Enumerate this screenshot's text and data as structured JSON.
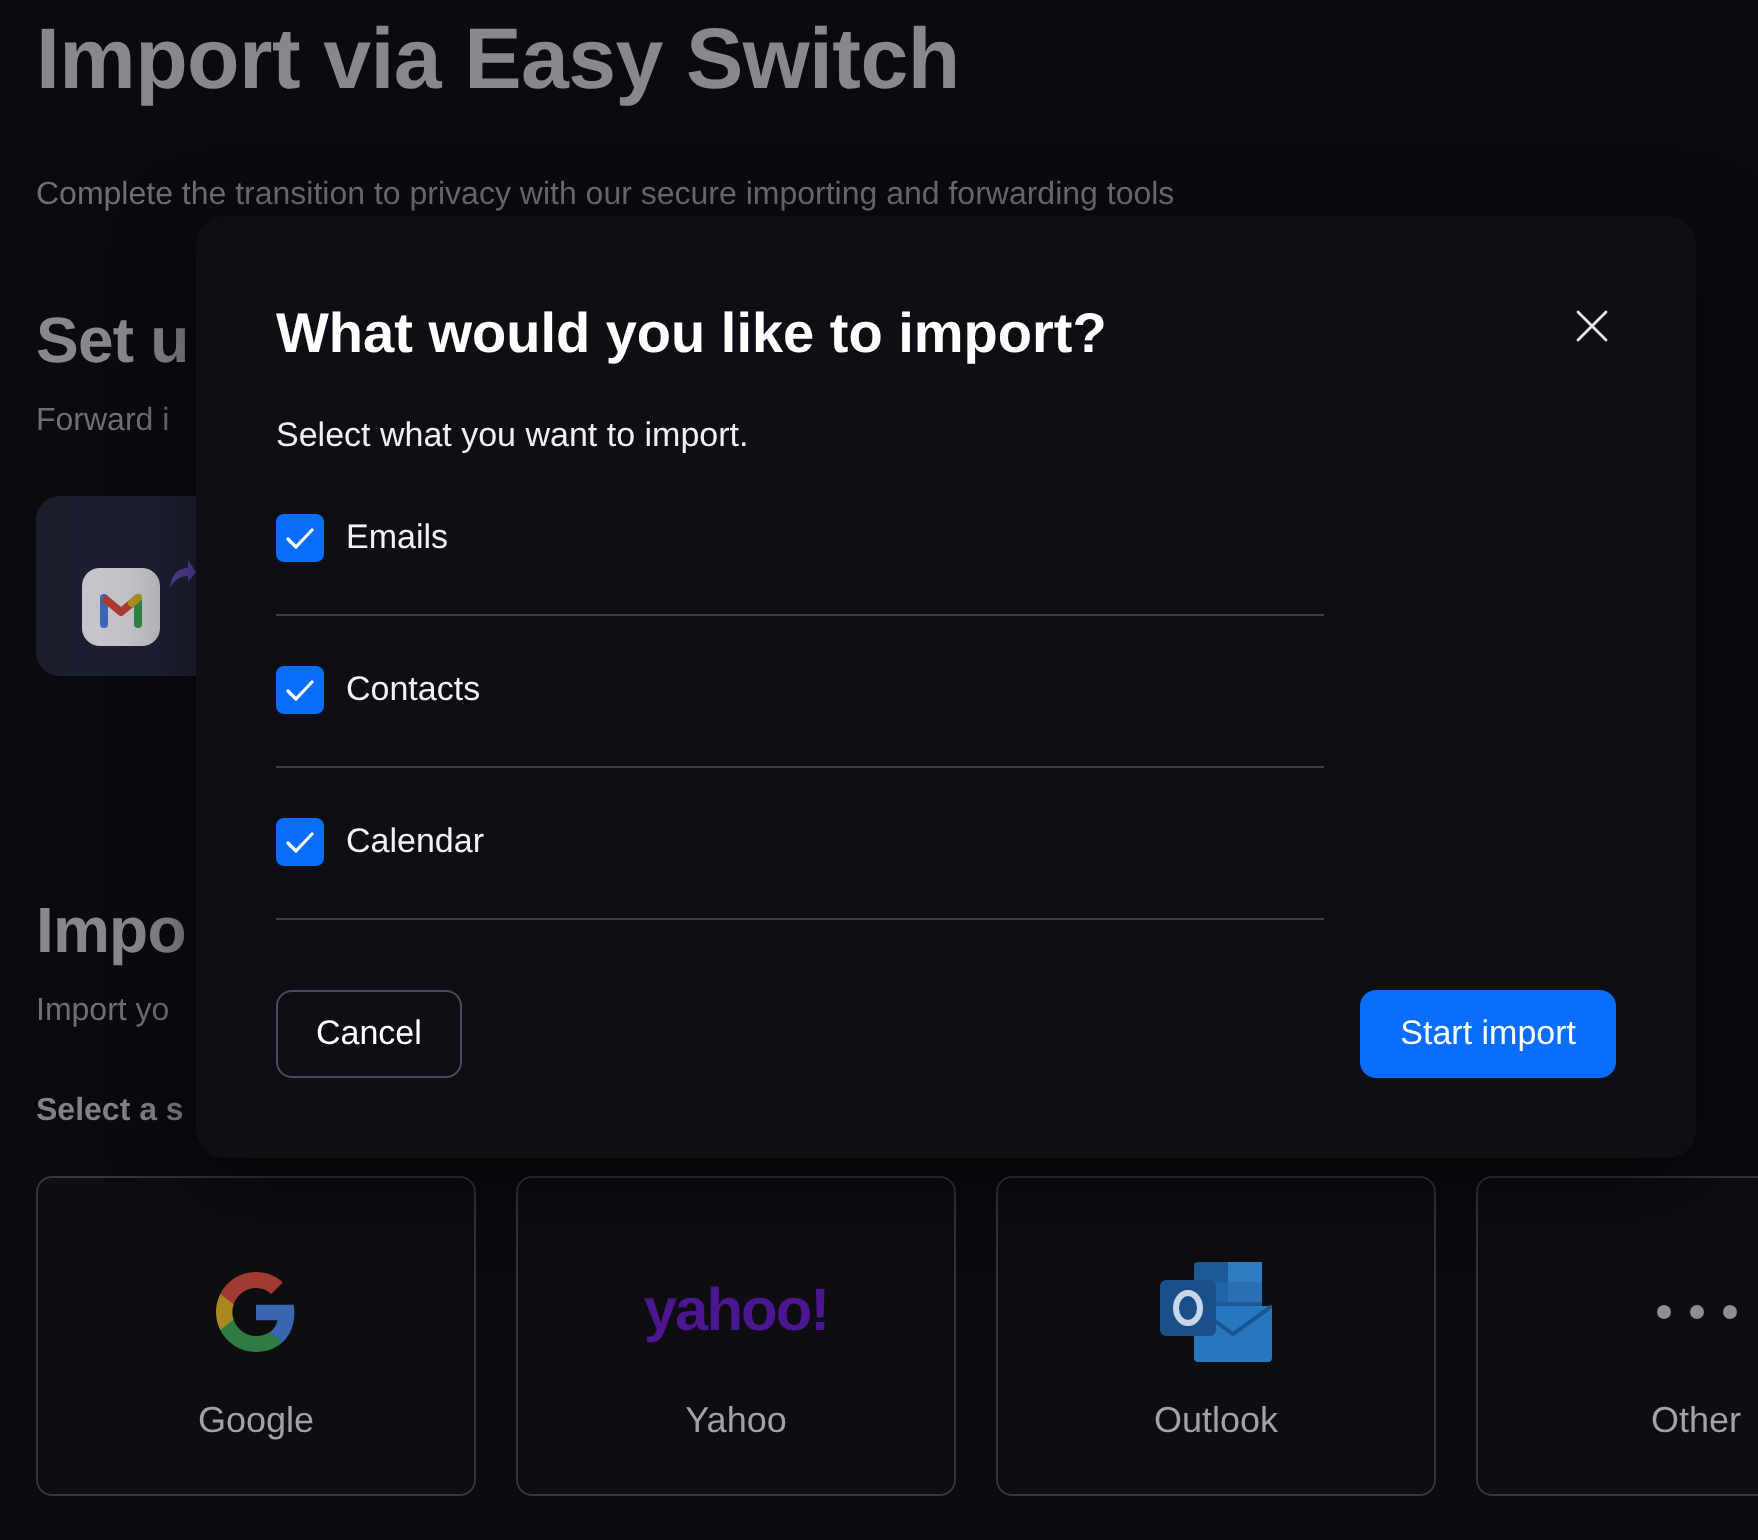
{
  "page": {
    "title": "Import via Easy Switch",
    "intro": "Complete the transition to privacy with our secure importing and forwarding tools"
  },
  "forwarding_section": {
    "heading": "Set u",
    "description": "Forward i"
  },
  "import_section": {
    "heading": "Impo",
    "description": "Import yo",
    "prompt": "Select a s",
    "providers": [
      {
        "kind": "google",
        "label": "Google"
      },
      {
        "kind": "yahoo",
        "label": "Yahoo",
        "logo_text": "yahoo!"
      },
      {
        "kind": "outlook",
        "label": "Outlook"
      },
      {
        "kind": "other",
        "label": "Other"
      }
    ]
  },
  "dialog": {
    "title": "What would you like to import?",
    "subtitle": "Select what you want to import.",
    "options": [
      {
        "label": "Emails",
        "checked": true
      },
      {
        "label": "Contacts",
        "checked": true
      },
      {
        "label": "Calendar",
        "checked": true
      }
    ],
    "buttons": [
      {
        "kind": "secondary",
        "label": "Cancel"
      },
      {
        "kind": "primary",
        "label": "Start import"
      }
    ]
  }
}
